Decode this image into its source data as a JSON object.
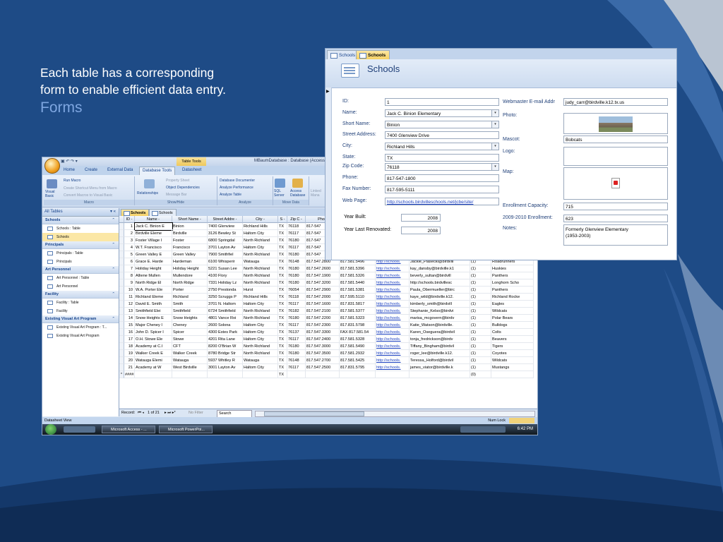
{
  "caption": {
    "line1": "Each table has a corresponding",
    "line2": "form to enable efficient data entry.",
    "heading": "Forms"
  },
  "colors": {
    "slide_bg": "#1e4b86",
    "accent_light": "#7ea6e0",
    "table_tools": "#f3d77a"
  },
  "access": {
    "qat_text": "▣ ↶ ↷ ▾",
    "table_tools": "Table Tools",
    "window_title": "MBaumDatabase : Database (Access 2007) - Micr",
    "tabs": [
      "Home",
      "Create",
      "External Data",
      "Database Tools",
      "Datasheet"
    ],
    "active_tab": "Database Tools",
    "ribbon": {
      "visual_basic": "Visual Basic",
      "run_macro": "Run Macro",
      "create_shortcut": "Create Shortcut Menu from Macro",
      "convert_macros": "Convert Macros to Visual Basic",
      "macro_group": "Macro",
      "relationships": "Relationships",
      "property_sheet": "Property Sheet",
      "object_dependencies": "Object Dependencies",
      "message_bar": "Message Bar",
      "showhide_group": "Show/Hide",
      "db_documenter": "Database Documenter",
      "analyze_perf": "Analyze Performance",
      "analyze_table": "Analyze Table",
      "analyze_group": "Analyze",
      "sql_server": "SQL Server",
      "access_db": "Access Database",
      "linked": "Linked Mana",
      "move_group": "Move Data"
    },
    "nav": {
      "header": "All Tables",
      "header_icons": "▾ «",
      "groups": [
        {
          "name": "Schools",
          "items": [
            "Schools : Table",
            "Schools"
          ]
        },
        {
          "name": "Principals",
          "items": [
            "Principals : Table",
            "Principals"
          ]
        },
        {
          "name": "Art Personnel",
          "items": [
            "Art Personnel : Table",
            "Art Personnel"
          ]
        },
        {
          "name": "Facility",
          "items": [
            "Facility : Table",
            "Facility"
          ]
        },
        {
          "name": "Existing Visual Art Program",
          "items": [
            "Existing Visual Art Program : T...",
            "Existing Visual Art Program"
          ]
        }
      ]
    },
    "doc_tabs": [
      "Schools",
      "Schools"
    ],
    "columns": [
      "ID -",
      "Name -",
      "Short Name -",
      "Street Addre -",
      "City -",
      "S -",
      "Zip C -",
      "Phon",
      "",
      "",
      "",
      "",
      ""
    ],
    "rows": [
      [
        "1",
        "Jack C. Binion E",
        "Binion",
        "7400 Glenview",
        "Richland Hills",
        "TX",
        "76118",
        "817-547",
        "",
        "",
        "",
        "",
        ""
      ],
      [
        "2",
        "Birdville Eleme",
        "Birdville",
        "3126 Bewley St",
        "Haltom City",
        "TX",
        "76117",
        "817-547",
        "",
        "",
        "",
        "",
        ""
      ],
      [
        "3",
        "Foster Village I",
        "Foster",
        "6800 Springdal",
        "North Richland",
        "TX",
        "76180",
        "817-547",
        "",
        "",
        "",
        "",
        ""
      ],
      [
        "4",
        "W.T. Francisco",
        "Francisco",
        "3701 Layton Av",
        "Haltom City",
        "TX",
        "76117",
        "817-547",
        "",
        "",
        "",
        "",
        ""
      ],
      [
        "5",
        "Green Valley E",
        "Green Valley",
        "7900 Smithfiel",
        "North Richland",
        "TX",
        "76180",
        "817-547",
        "",
        "",
        "",
        "",
        ""
      ],
      [
        "6",
        "Grace E. Harde",
        "Hardeman",
        "6100 Whisperir",
        "Watauga",
        "TX",
        "76148",
        "817.547.2800",
        "817.581.5496",
        "http://schools.",
        "Jackie_Piasecki@birdvill",
        "(1)",
        "Roadrunners"
      ],
      [
        "7",
        "Holiday Height",
        "Holiday Height",
        "5221 Susan Lee",
        "North Richland",
        "TX",
        "76180",
        "817.547.2600",
        "817.581.5396",
        "http://schools.",
        "kay_dansby@birdville.k1",
        "(1)",
        "Huskies"
      ],
      [
        "8",
        "Alliene Mullen",
        "Mullendore",
        "4100 Flory",
        "North Richland",
        "TX",
        "76180",
        "817.547.1900",
        "817.581.5326",
        "http://schools.",
        "beverly_sultan@birdvill",
        "(1)",
        "Panthers"
      ],
      [
        "9",
        "North Ridge El",
        "North Ridge",
        "7331 Holiday Lz",
        "North Richland",
        "TX",
        "76180",
        "817.547.3200",
        "817.581.5440",
        "http://schools.",
        "http://schools.birdvillesc",
        "(1)",
        "Longhorn Scho"
      ],
      [
        "10",
        "W.A. Porter Ele",
        "Porter",
        "2750 Prestonda",
        "Hurst",
        "TX",
        "76054",
        "817.547.2900",
        "817.581.5381",
        "http://schools.",
        "Paula_Obermueller@birc",
        "(1)",
        "Panthers"
      ],
      [
        "11",
        "Richland Eleme",
        "Richland",
        "3250 Scruggs P",
        "Richland Hills",
        "TX",
        "76118",
        "817.547.2000",
        "817.595.5110",
        "http://schools.",
        "kaye_wild@birdville.k12.",
        "(1)",
        "Richland Rocke"
      ],
      [
        "12",
        "David E. Smith",
        "Smith",
        "3701 N. Haltom",
        "Haltom City",
        "TX",
        "76117",
        "817.547.1600",
        "817.831.5817",
        "http://schools.",
        "kimberly_smith@birdvill",
        "(1)",
        "Eagles"
      ],
      [
        "13",
        "Smithfield Elei",
        "Smithfield",
        "6724 Smithfield",
        "North Richland",
        "TX",
        "76182",
        "817.547.2100",
        "817.581.5377",
        "http://schools.",
        "Stephanie_Kelso@birdvi",
        "(1)",
        "Wildcats"
      ],
      [
        "14",
        "Snow Heights E",
        "Snow Heights",
        "4801 Vance Roi",
        "North Richland",
        "TX",
        "76180",
        "817.547.2200",
        "817.581.5323",
        "http://schools.",
        "marisa_mcgovern@birdv",
        "(1)",
        "Polar Bears"
      ],
      [
        "15",
        "Major Cheney I",
        "Cheney",
        "2600 Solona",
        "Haltom City",
        "TX",
        "76117",
        "817.547.2300",
        "817.831.5798",
        "http://schools.",
        "Katie_Watson@birdville.",
        "(1)",
        "Bulldogs"
      ],
      [
        "16",
        "John D. Spicer I",
        "Spicer",
        "4300 Estes Park",
        "Haltom City",
        "TX",
        "76137",
        "817.547.3300",
        "FAX 817.581.54",
        "http://schools.",
        "Karen_Oseguera@birdvil",
        "(1)",
        "Colts"
      ],
      [
        "17",
        "O.H. Stowe Ele",
        "Stowe",
        "4201 Rita Lane",
        "Haltom City",
        "TX",
        "76117",
        "817.547.2400",
        "817.581.5328",
        "http://schools.",
        "tonja_fredrickson@birdv",
        "(1)",
        "Beavers"
      ],
      [
        "18",
        "Academy at C.I",
        "CFT",
        "8200 O'Brian W",
        "North Richland",
        "TX",
        "76180",
        "817.547.3000",
        "817.581.5490",
        "http://schools.",
        "Tiffany_Bingham@birdvil",
        "(1)",
        "Tigers"
      ],
      [
        "19",
        "Walker Creek E",
        "Walker Creek",
        "8780 Bridge Str",
        "North Richland",
        "TX",
        "76180",
        "817.547.3500",
        "817.581.2932",
        "http://schools.",
        "roger_lee@birdville.k12.",
        "(1)",
        "Coyotes"
      ],
      [
        "20",
        "Watauga Elemi",
        "Watauga",
        "5937 Whitley R",
        "Watauga",
        "TX",
        "76148",
        "817.547.2700",
        "817.581.5425",
        "http://schools.",
        "Teressa_Holford@birdvil",
        "(1)",
        "Wildcats"
      ],
      [
        "21",
        "Academy at W",
        "West Birdville",
        "3001 Layton Av",
        "Haltom City",
        "TX",
        "76117",
        "817.547.2500",
        "817.831.5795",
        "http://schools.",
        "james_viator@birdville.k",
        "(1)",
        "Mustangs"
      ],
      [
        "####",
        "",
        "",
        "",
        "",
        "TX",
        "",
        "",
        "",
        "",
        "",
        "(0)",
        ""
      ]
    ],
    "new_row_marker": "*",
    "recnav": {
      "record_label": "Record:",
      "position": "1 of 21",
      "no_filter": "No Filter",
      "search": "Search"
    },
    "status_left": "Datasheet View",
    "status_right": "Num Lock",
    "taskbar": {
      "btn1": "Microsoft Access - ...",
      "btn2": "Microsoft PowerPoi...",
      "clock": "6:42 PM"
    }
  },
  "form": {
    "tabs": [
      "Schools",
      "Schools"
    ],
    "title": "Schools",
    "id_label": "ID:",
    "id_value": "1",
    "name_label": "Name:",
    "name_value": "Jack C. Binion Elementary",
    "short_label": "Short Name:",
    "short_value": "Binion",
    "street_label": "Street Address:",
    "street_value": "7400 Glenview Drive",
    "city_label": "City:",
    "city_value": "Richland Hills",
    "state_label": "State:",
    "state_value": "TX",
    "zip_label": "Zip Code:",
    "zip_value": "76118",
    "phone_label": "Phone:",
    "phone_value": "817-547-1800",
    "fax_label": "Fax Number:",
    "fax_value": "817-595-5111",
    "web_label": "Web Page:",
    "web_value": "http://schools.birdvilleschools.net/jcbe/site/",
    "year_built_label": "Year Built:",
    "year_built_value": "2008",
    "year_reno_label": "Year Last Renovated:",
    "year_reno_value": "2008",
    "webmaster_label": "Webmaster E-mail Addr",
    "webmaster_value": "judy_carr@birdville.k12.tx.us",
    "photo_label": "Photo:",
    "mascot_label": "Mascot:",
    "mascot_value": "Bobcats",
    "logo_label": "Logo:",
    "map_label": "Map:",
    "capacity_label": "Enrollment Capacity:",
    "capacity_value": "715",
    "enroll_label": "2009-2010 Enrollment:",
    "enroll_value": "623",
    "notes_label": "Notes:",
    "notes_line1": "Formerly Glenview Elementary",
    "notes_line2": "(1953-2003)"
  }
}
